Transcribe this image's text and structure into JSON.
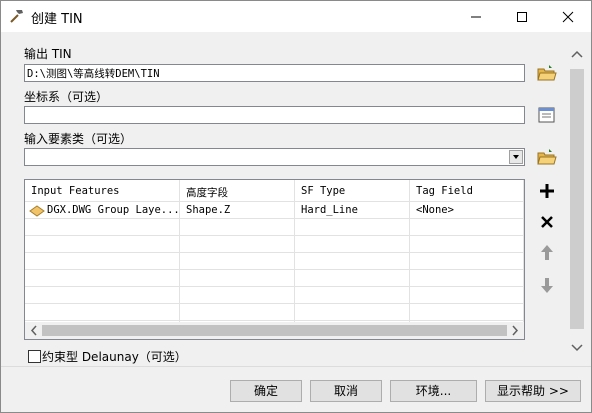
{
  "window": {
    "title": "创建 TIN"
  },
  "output_tin": {
    "label": "输出 TIN",
    "value": "D:\\测图\\等高线转DEM\\TIN"
  },
  "coordinate_system": {
    "label": "坐标系（可选）",
    "value": ""
  },
  "input_features": {
    "label": "输入要素类（可选）",
    "value": ""
  },
  "table": {
    "columns": [
      "Input Features",
      "高度字段",
      "SF Type",
      "Tag Field"
    ],
    "rows": [
      [
        "DGX.DWG Group Laye...",
        "Shape.Z",
        "Hard_Line",
        "<None>"
      ]
    ]
  },
  "constrained": {
    "label": "约束型 Delaunay（可选）",
    "checked": false
  },
  "buttons": {
    "ok": "确定",
    "cancel": "取消",
    "environments": "环境...",
    "show_help": "显示帮助 >>"
  }
}
